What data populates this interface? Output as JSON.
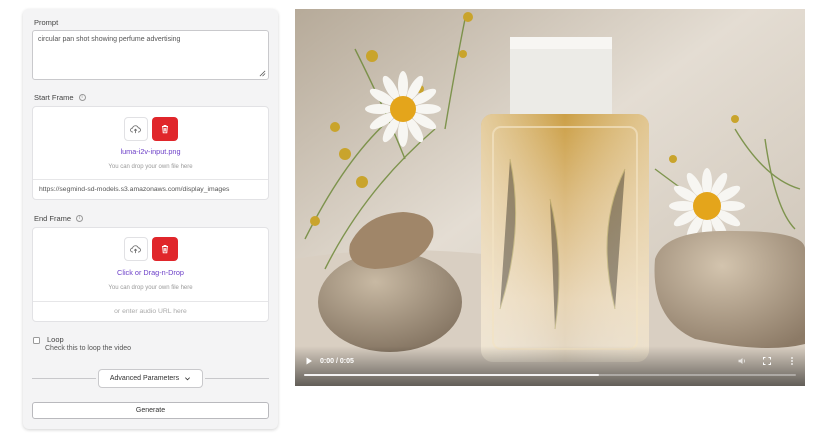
{
  "prompt": {
    "label": "Prompt",
    "value": "circular pan shot showing perfume advertising"
  },
  "start_frame": {
    "label": "Start Frame",
    "file_name": "luma-i2v-input.png",
    "drop_hint": "You can drop your own file here",
    "url_value": "https://segmind-sd-models.s3.amazonaws.com/display_images"
  },
  "end_frame": {
    "label": "End Frame",
    "upload_prompt": "Click or Drag-n-Drop",
    "drop_hint": "You can drop your own file here",
    "url_placeholder": "or enter audio URL here"
  },
  "loop": {
    "label": "Loop",
    "description": "Check this to loop the video",
    "checked": false
  },
  "advanced_label": "Advanced Parameters",
  "generate_label": "Generate",
  "video": {
    "time": "0:00 / 0:05",
    "progress": 0.6
  },
  "colors": {
    "accent_purple": "#6c3fc8",
    "delete_red": "#e0262b"
  },
  "icons": [
    "info-icon",
    "upload-icon",
    "trash-icon",
    "chevron-down-icon",
    "play-icon",
    "volume-icon",
    "fullscreen-icon",
    "more-icon",
    "resize-handle-icon"
  ]
}
